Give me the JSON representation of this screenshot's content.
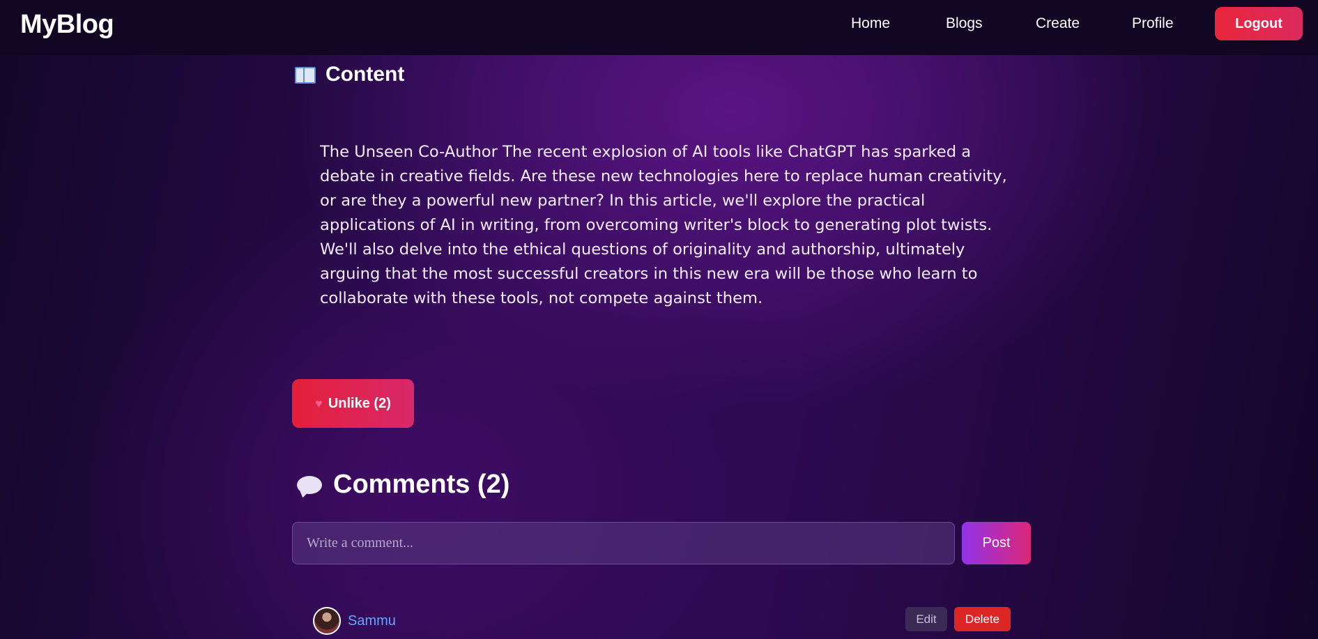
{
  "navbar": {
    "logo": "MyBlog",
    "links": [
      "Home",
      "Blogs",
      "Create",
      "Profile"
    ],
    "logout_label": "Logout"
  },
  "content": {
    "heading": "Content",
    "heading_icon": "open-book-icon",
    "body": "The Unseen Co-Author The recent explosion of AI tools like ChatGPT has sparked a debate in creative fields. Are these new technologies here to replace human creativity, or are they a powerful new partner? In this article, we'll explore the practical applications of AI in writing, from overcoming writer's block to generating plot twists. We'll also delve into the ethical questions of originality and authorship, ultimately arguing that the most successful creators in this new era will be those who learn to collaborate with these tools, not compete against them."
  },
  "like": {
    "icon": "heart-icon",
    "label": "Unlike (2)"
  },
  "comments": {
    "heading": "Comments (2)",
    "heading_icon": "speech-bubble-icon",
    "input_placeholder": "Write a comment...",
    "input_value": "",
    "post_label": "Post",
    "items": [
      {
        "author": "Sammu",
        "edit_label": "Edit",
        "delete_label": "Delete"
      }
    ]
  },
  "colors": {
    "accent_red": "#e3203a",
    "accent_purple": "#9333ea",
    "author_link": "#66a6ff",
    "navbar_bg": "#120625"
  }
}
